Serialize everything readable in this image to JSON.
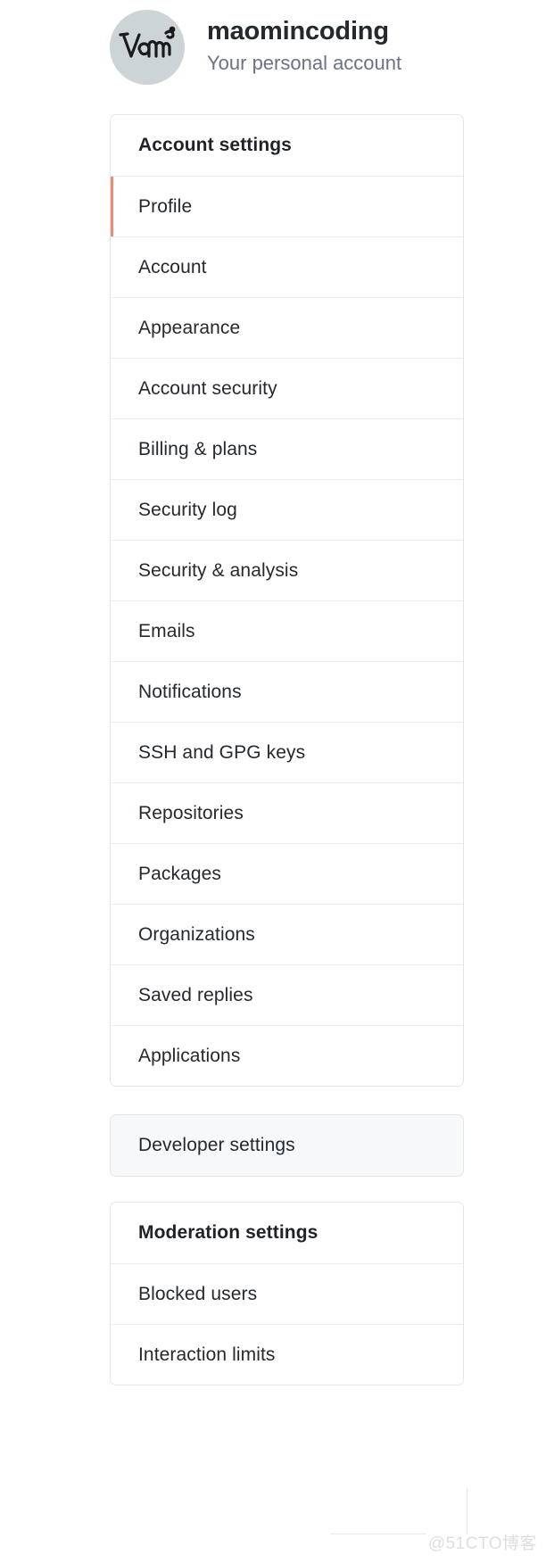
{
  "header": {
    "account_name": "maomincoding",
    "account_subtitle": "Your personal account",
    "avatar_alt": "Vam",
    "avatar_bg": "#ccd4d6"
  },
  "account_settings": {
    "heading": "Account settings",
    "selected_indicator_color": "#ec8b72",
    "items": [
      {
        "label": "Profile",
        "selected": true
      },
      {
        "label": "Account",
        "selected": false
      },
      {
        "label": "Appearance",
        "selected": false
      },
      {
        "label": "Account security",
        "selected": false
      },
      {
        "label": "Billing & plans",
        "selected": false
      },
      {
        "label": "Security log",
        "selected": false
      },
      {
        "label": "Security & analysis",
        "selected": false
      },
      {
        "label": "Emails",
        "selected": false
      },
      {
        "label": "Notifications",
        "selected": false
      },
      {
        "label": "SSH and GPG keys",
        "selected": false
      },
      {
        "label": "Repositories",
        "selected": false
      },
      {
        "label": "Packages",
        "selected": false
      },
      {
        "label": "Organizations",
        "selected": false
      },
      {
        "label": "Saved replies",
        "selected": false
      },
      {
        "label": "Applications",
        "selected": false
      }
    ]
  },
  "developer_settings": {
    "label": "Developer settings",
    "background": "#f6f8fa"
  },
  "moderation_settings": {
    "heading": "Moderation settings",
    "items": [
      {
        "label": "Blocked users"
      },
      {
        "label": "Interaction limits"
      }
    ]
  },
  "watermark": {
    "text": "@51CTO博客"
  }
}
